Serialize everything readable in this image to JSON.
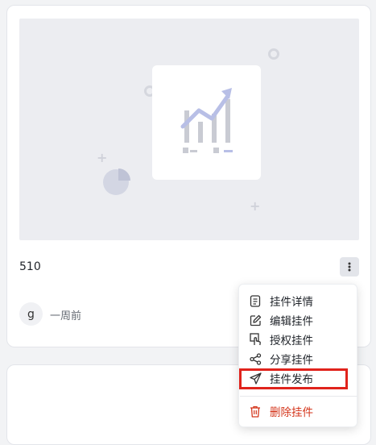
{
  "card": {
    "title": "510",
    "avatar_letter": "g",
    "time": "一周前"
  },
  "menu": {
    "items": [
      {
        "label": "挂件详情",
        "icon": "document-icon"
      },
      {
        "label": "编辑挂件",
        "icon": "edit-icon"
      },
      {
        "label": "授权挂件",
        "icon": "authorize-icon"
      },
      {
        "label": "分享挂件",
        "icon": "share-icon"
      },
      {
        "label": "挂件发布",
        "icon": "send-icon"
      }
    ],
    "delete": {
      "label": "删除挂件",
      "icon": "trash-icon"
    }
  },
  "colors": {
    "danger": "#d4361c",
    "highlight": "#e0231c",
    "chart_blue": "#b8bfe6",
    "chart_gray": "#c9cbd3"
  }
}
